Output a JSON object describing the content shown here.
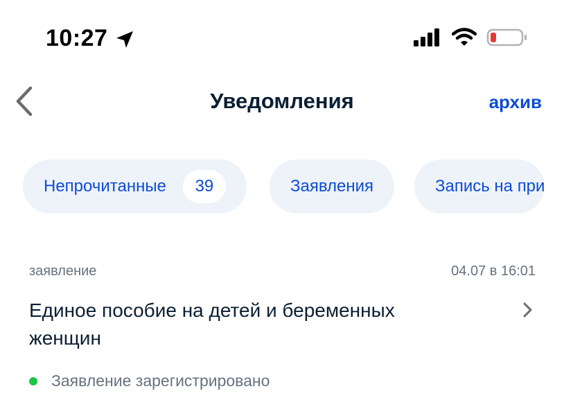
{
  "status_bar": {
    "time": "10:27",
    "icons": [
      "location-arrow-icon",
      "cellular-signal-icon",
      "wifi-icon",
      "battery-low-icon"
    ],
    "battery_color": "#e53935"
  },
  "nav": {
    "back_icon": "chevron-left-icon",
    "title": "Уведомления",
    "archive_label": "архив"
  },
  "filters": [
    {
      "label": "Непрочитанные",
      "count": "39"
    },
    {
      "label": "Заявления"
    },
    {
      "label": "Запись на при"
    }
  ],
  "notification": {
    "category": "заявление",
    "date": "04.07 в 16:01",
    "title": "Единое пособие на детей и беременных женщин",
    "status": "Заявление зарегистрировано",
    "status_color": "#1ec449"
  },
  "colors": {
    "accent": "#0d4cd3",
    "chip_bg": "#eef3fa",
    "text_primary": "#0b1f33",
    "text_secondary": "#66727f"
  }
}
